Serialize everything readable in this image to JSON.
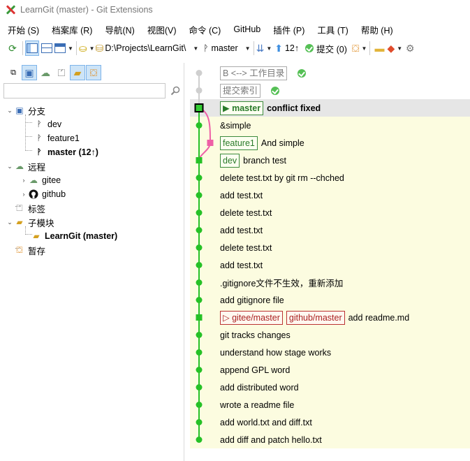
{
  "window": {
    "title": "LearnGit (master) - Git Extensions"
  },
  "menu": [
    "开始 (S)",
    "档案库 (R)",
    "导航(N)",
    "视图(V)",
    "命令 (C)",
    "GitHub",
    "插件 (P)",
    "工具 (T)",
    "帮助 (H)"
  ],
  "toolbar": {
    "repo_path": "D:\\Projects\\LearnGit\\",
    "branch": "master",
    "push_count": "12↑",
    "commit_label": "提交 (0)"
  },
  "left": {
    "search_placeholder": "",
    "tree": {
      "branches_label": "分支",
      "branches": [
        "dev",
        "feature1",
        "master (12↑)"
      ],
      "remotes_label": "远程",
      "remotes": [
        "gitee",
        "github"
      ],
      "tags_label": "标签",
      "submodules_label": "子模块",
      "submodules": [
        "LearnGit (master)"
      ],
      "stash_label": "暂存"
    }
  },
  "colors": {
    "graph_green": "#26c126",
    "graph_pink": "#ee5fa6",
    "graph_bg": "#fcfce0",
    "ref_green": "#2a7a2a",
    "ref_red": "#a22"
  },
  "commits": [
    {
      "virtual": true,
      "refs": [
        {
          "text": "B <--> 工作目录",
          "kind": "virtual"
        }
      ],
      "message": "",
      "status": true
    },
    {
      "virtual": true,
      "refs": [
        {
          "text": "提交索引",
          "kind": "virtual"
        }
      ],
      "message": "",
      "status": true
    },
    {
      "selected": true,
      "refs": [
        {
          "text": "▶ master",
          "kind": "head"
        }
      ],
      "message": "conflict fixed",
      "bold": true
    },
    {
      "refs": [],
      "message": "&simple"
    },
    {
      "refs": [
        {
          "text": "feature1",
          "kind": "local"
        }
      ],
      "message": "And simple"
    },
    {
      "refs": [
        {
          "text": "dev",
          "kind": "local"
        }
      ],
      "message": "branch test"
    },
    {
      "refs": [],
      "message": "delete test.txt by git rm --chched"
    },
    {
      "refs": [],
      "message": "add test.txt"
    },
    {
      "refs": [],
      "message": "delete test.txt"
    },
    {
      "refs": [],
      "message": "add test.txt"
    },
    {
      "refs": [],
      "message": "delete test.txt"
    },
    {
      "refs": [],
      "message": "add test.txt"
    },
    {
      "refs": [],
      "message": ".gitignore文件不生效，重新添加"
    },
    {
      "refs": [],
      "message": "add gitignore file"
    },
    {
      "refs": [
        {
          "text": "▷ gitee/master",
          "kind": "remote"
        },
        {
          "text": "github/master",
          "kind": "remote"
        }
      ],
      "message": "add readme.md"
    },
    {
      "refs": [],
      "message": "git tracks changes"
    },
    {
      "refs": [],
      "message": "understand how stage works"
    },
    {
      "refs": [],
      "message": "append GPL word"
    },
    {
      "refs": [],
      "message": "add distributed word"
    },
    {
      "refs": [],
      "message": "wrote a readme file"
    },
    {
      "refs": [],
      "message": "add world.txt and diff.txt"
    },
    {
      "refs": [],
      "message": "add diff and patch hello.txt"
    }
  ]
}
